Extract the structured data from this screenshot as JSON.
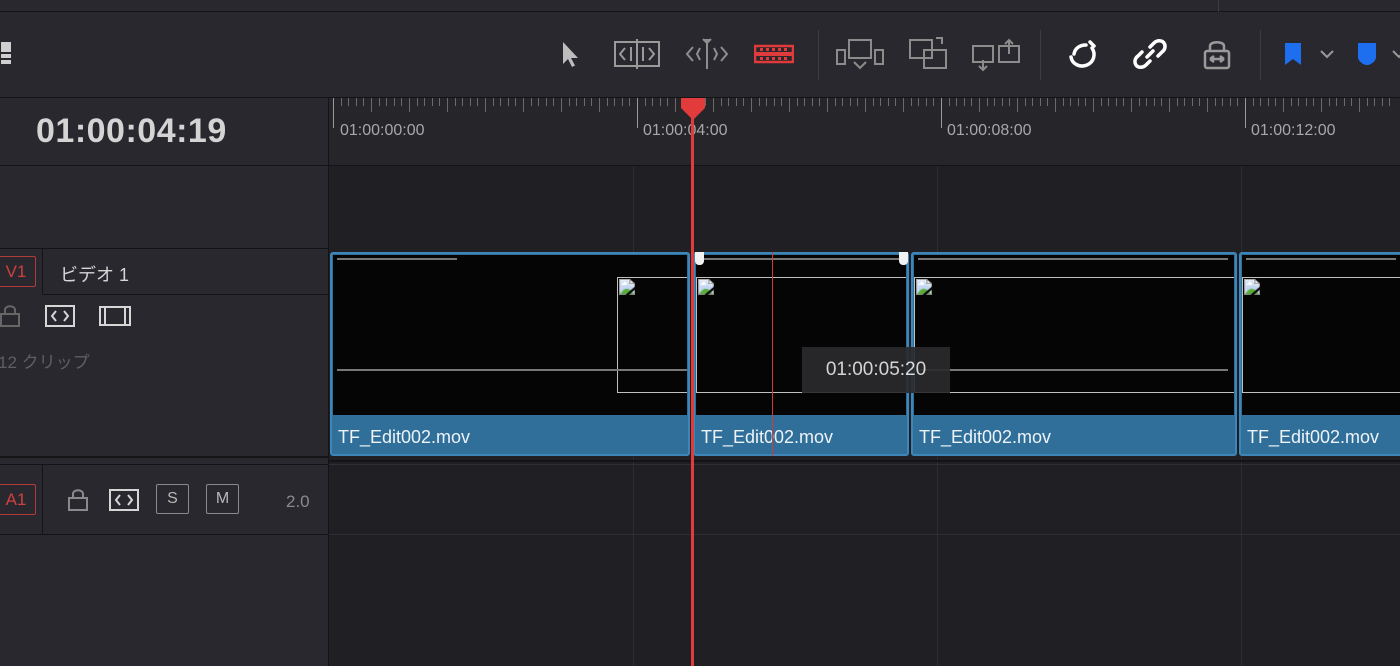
{
  "timecode": "01:00:04:19",
  "ruler": {
    "labels": [
      "01:00:00:00",
      "01:00:04:00",
      "01:00:08:00",
      "01:00:12:00"
    ]
  },
  "toolbar": {
    "icons": [
      "layout-icon",
      "select-arrow-icon",
      "trim-edit-icon",
      "dynamic-trim-icon",
      "blade-razor-icon",
      "insert-clip-icon",
      "overwrite-clip-icon",
      "replace-clip-icon",
      "snapping-magnet-icon",
      "linked-selection-icon",
      "position-lock-icon",
      "flag-icon",
      "marker-icon"
    ],
    "accent": "#e03a3a",
    "blue": "#1e6ff0"
  },
  "video_track": {
    "badge": "V1",
    "name": "ビデオ 1",
    "clip_count": "12 クリップ",
    "clips": [
      {
        "name": "TF_Edit002.mov"
      },
      {
        "name": "TF_Edit002.mov"
      },
      {
        "name": "TF_Edit002.mov"
      },
      {
        "name": "TF_Edit002.mov"
      }
    ]
  },
  "audio_track": {
    "badge": "A1",
    "solo_label": "S",
    "mute_label": "M",
    "channel": "2.0"
  },
  "tooltip": "01:00:05:20",
  "colors": {
    "clip_fill": "#2f6f9a",
    "playhead": "#e23b3b"
  }
}
